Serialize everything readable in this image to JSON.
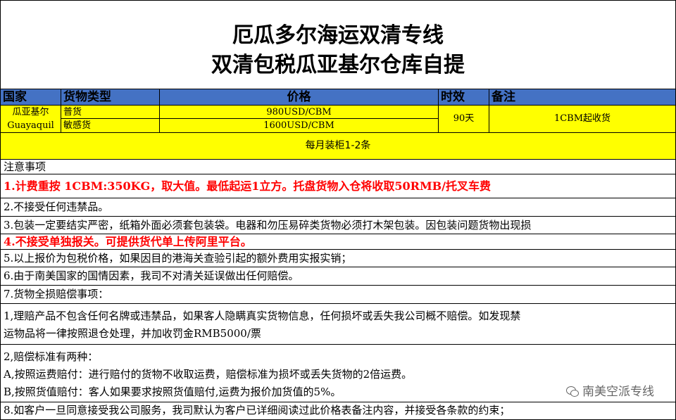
{
  "title": {
    "line1": "厄瓜多尔海运双清专线",
    "line2": "双清包税瓜亚基尔仓库自提"
  },
  "header": {
    "country": "国家",
    "cargo_type": "货物类型",
    "price": "价格",
    "transit_time": "时效",
    "remarks": "备注"
  },
  "rates": {
    "country_cn": "瓜亚基尔",
    "country_en": "Guayaquil",
    "rows": [
      {
        "cargo_type": "普货",
        "price": "980USD/CBM"
      },
      {
        "cargo_type": "敏感货",
        "price": "1600USD/CBM"
      }
    ],
    "transit_time": "90天",
    "remarks": "1CBM起收货"
  },
  "schedule": "每月装柜1-2条",
  "notes": {
    "heading": "注意事项",
    "n1": "1.计费重按 1CBM:350KG，取大值。最低起运1立方。托盘货物入仓将收取50RMB/托叉车费",
    "n2": "2.不接受任何违禁品。",
    "n3": "3.包装一定要结实严密，纸箱外面必须套包装袋。电器和勿压易碎类货物必须打木架包装。因包装问题货物出现损",
    "n4": "4.不接受单独报关。可提供货代单上传阿里平台。",
    "n5": "5.以上报价为包税价格，如果因目的港海关查验引起的额外费用实报实销；",
    "n6": "6.由于南美国家的国情因素，我司不对清关延误做出任何赔偿。",
    "n7": "7.货物全损赔偿事项：",
    "n7_1_line1": " 1,理赔产品不包含任何名牌或违禁品，如果客人隐瞒真实货物信息，任何损坏或丢失我公司概不赔偿。如发现禁",
    "n7_1_line2": "运物品将一律按照退仓处理，并加收罚金RMB5000/票",
    "n7_2_line1": " 2,赔偿标准有两种：",
    "n7_2_line2": "  A,按照运费赔付：进行赔付的货物不收取运费，赔偿标准为损坏或丢失货物的2倍运费。",
    "n7_2_line3": "  B,按照货值赔付：客人如果要求按照货值赔付,运费为报价加货值的5%。",
    "n8": "8.如客户一旦同意接受我公司服务，我司默认为客户已详细阅读过此价格表备注内容，并接受各条款的约束；"
  },
  "watermark": "南美空派专线",
  "colors": {
    "header_bg": "#4472c4",
    "highlight": "#ffff00",
    "alert_text": "#ff0000"
  }
}
